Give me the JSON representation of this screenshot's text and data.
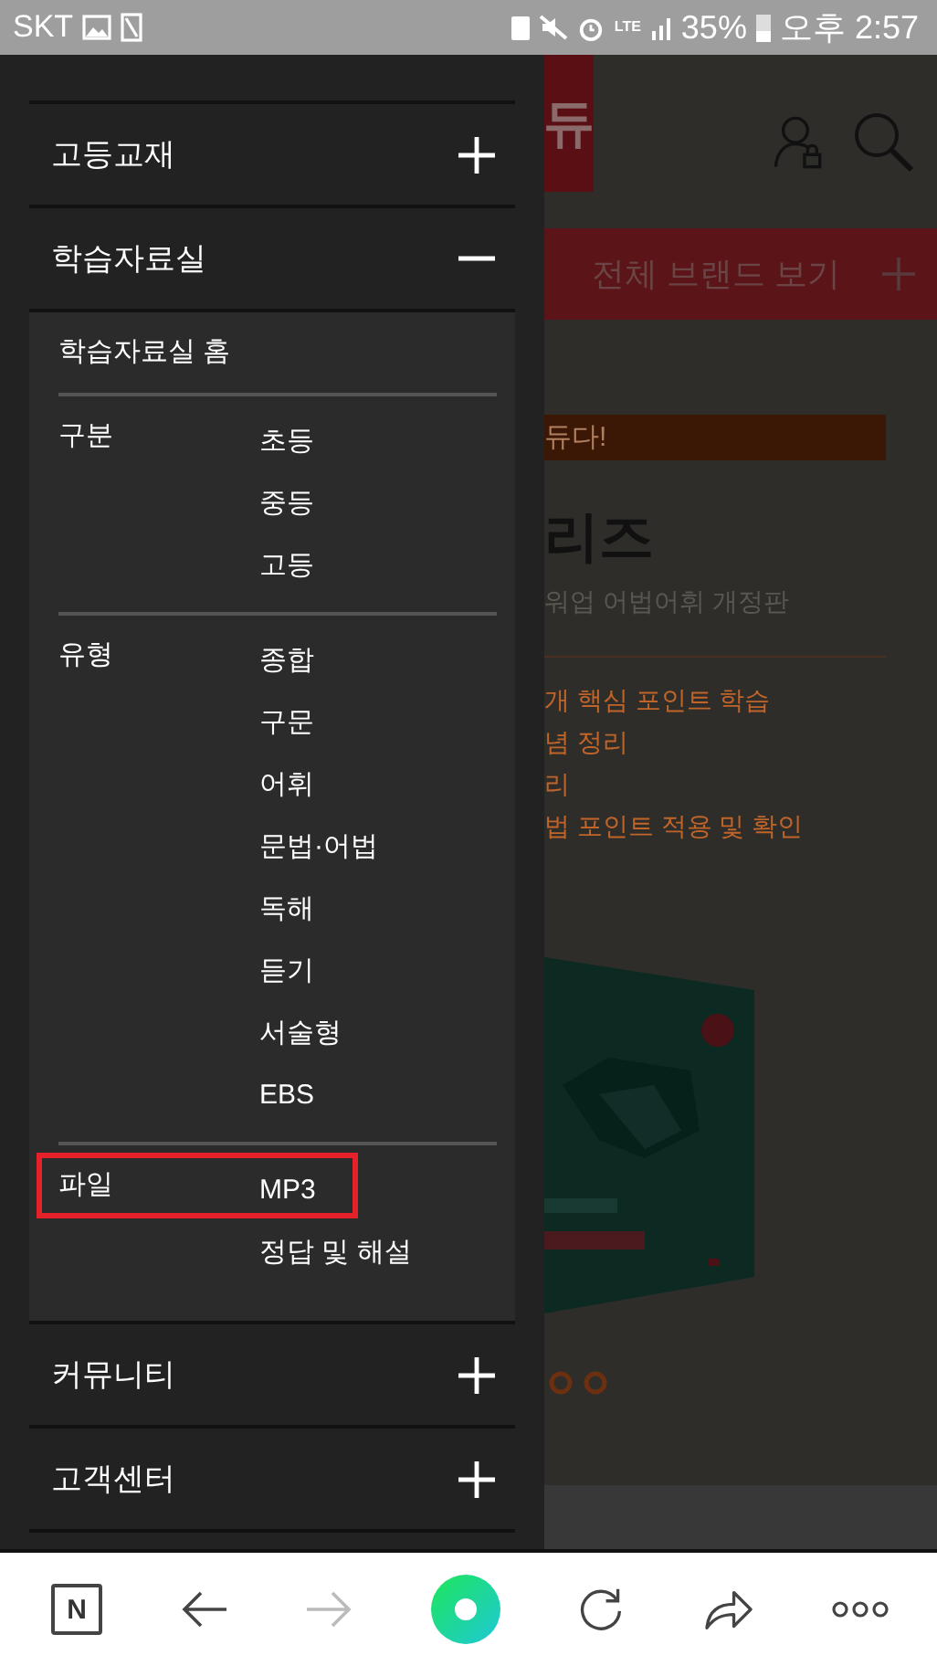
{
  "status_bar": {
    "carrier": "SKT",
    "signal_label": "LTE",
    "battery": "35%",
    "time": "오후 2:57"
  },
  "drawer": {
    "items": [
      {
        "label": "고등교재",
        "expanded": false
      },
      {
        "label": "학습자료실",
        "expanded": true,
        "submenu": {
          "home": "학습자료실 홈",
          "groups": [
            {
              "label": "구분",
              "highlighted": false,
              "items": [
                "초등",
                "중등",
                "고등"
              ]
            },
            {
              "label": "유형",
              "highlighted": false,
              "items": [
                "종합",
                "구문",
                "어휘",
                "문법·어법",
                "독해",
                "듣기",
                "서술형",
                "EBS"
              ]
            },
            {
              "label": "파일",
              "highlighted": true,
              "items": [
                "MP3",
                "정답 및 해설"
              ]
            }
          ]
        }
      },
      {
        "label": "커뮤니티",
        "expanded": false
      },
      {
        "label": "고객센터",
        "expanded": false
      }
    ]
  },
  "page": {
    "logo_fragment": "듀",
    "brand_button": "전체 브랜드 보기",
    "banner": "듀다!",
    "title": "리즈",
    "subtitle": "워업 어법어휘 개정판",
    "features": [
      "개 핵심 포인트 학습",
      "념 정리",
      "리",
      "법 포인트 적용 및 확인"
    ]
  },
  "browser_bar": {
    "logo": "N"
  }
}
